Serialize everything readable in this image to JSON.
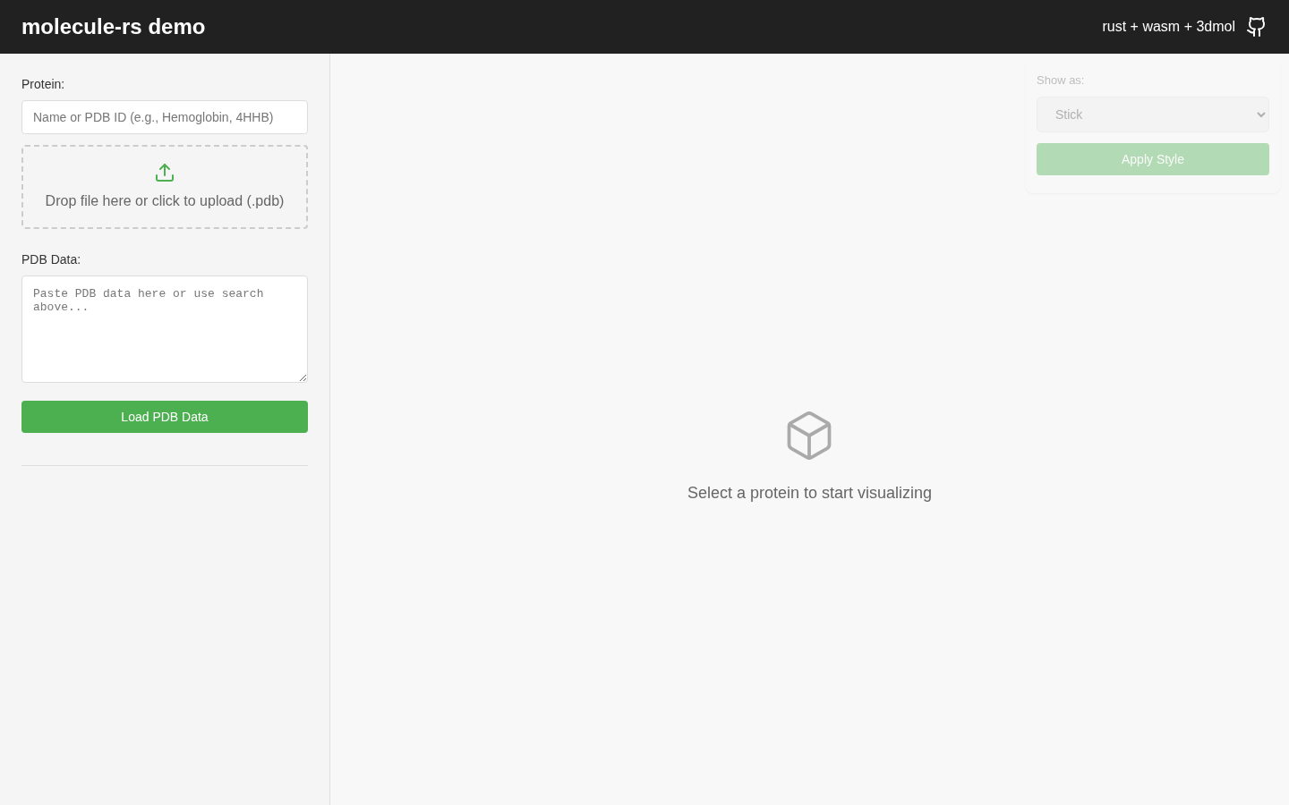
{
  "header": {
    "title": "molecule-rs demo",
    "tagline": "rust + wasm + 3dmol"
  },
  "sidebar": {
    "protein_label": "Protein:",
    "protein_field": {
      "placeholder": "Name or PDB ID (e.g., Hemoglobin, 4HHB)"
    },
    "upload": {
      "text": "Drop file here or click to upload (.pdb)"
    },
    "pdb_label": "PDB Data:",
    "pdb_field": {
      "placeholder": "Paste PDB data here or use search above..."
    },
    "load_button": "Load PDB Data"
  },
  "style_panel": {
    "disabled": true,
    "label": "Show as:",
    "select": {
      "value": "Stick"
    },
    "apply_button": "Apply Style"
  },
  "viewer": {
    "empty_message": "Select a protein to start visualizing"
  }
}
